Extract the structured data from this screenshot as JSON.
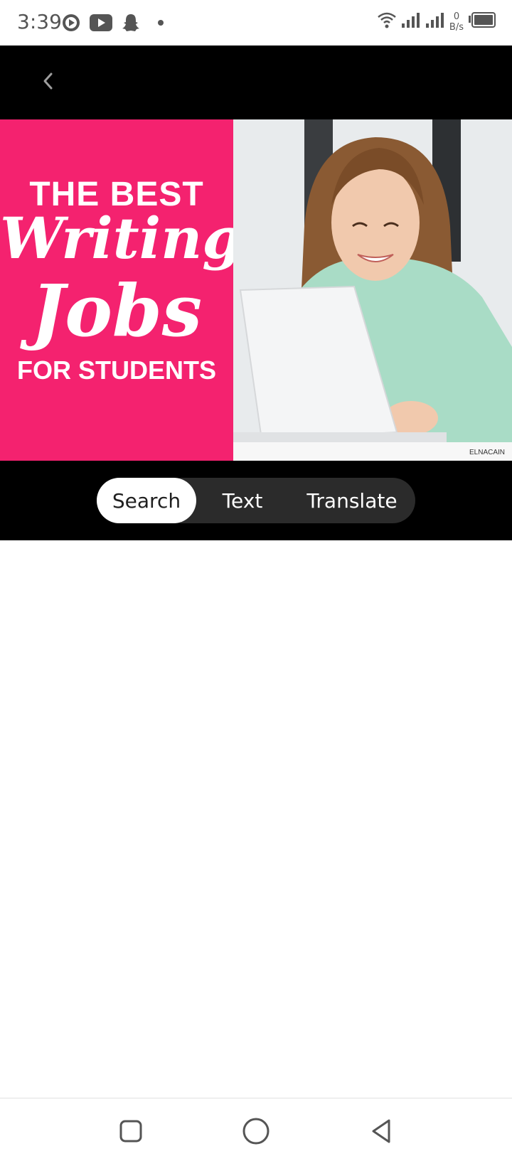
{
  "status_bar": {
    "time": "3:39",
    "net_speed_value": "0",
    "net_speed_unit": "B/s",
    "icons": [
      "recorder-icon",
      "youtube-icon",
      "snapchat-icon",
      "notification-dot-icon",
      "wifi-icon",
      "signal-icon",
      "signal-icon",
      "battery-icon"
    ]
  },
  "image": {
    "line1": "THE BEST",
    "line2": "Writing",
    "line3": "Jobs",
    "line4": "FOR STUDENTS",
    "credit": "ELNACAIN",
    "accent_color": "#f4226f"
  },
  "mode_tabs": [
    {
      "label": "Search",
      "active": true
    },
    {
      "label": "Text",
      "active": false
    },
    {
      "label": "Translate",
      "active": false
    }
  ],
  "nav_bar": {
    "buttons": [
      "recents-button",
      "home-button",
      "back-button"
    ]
  }
}
